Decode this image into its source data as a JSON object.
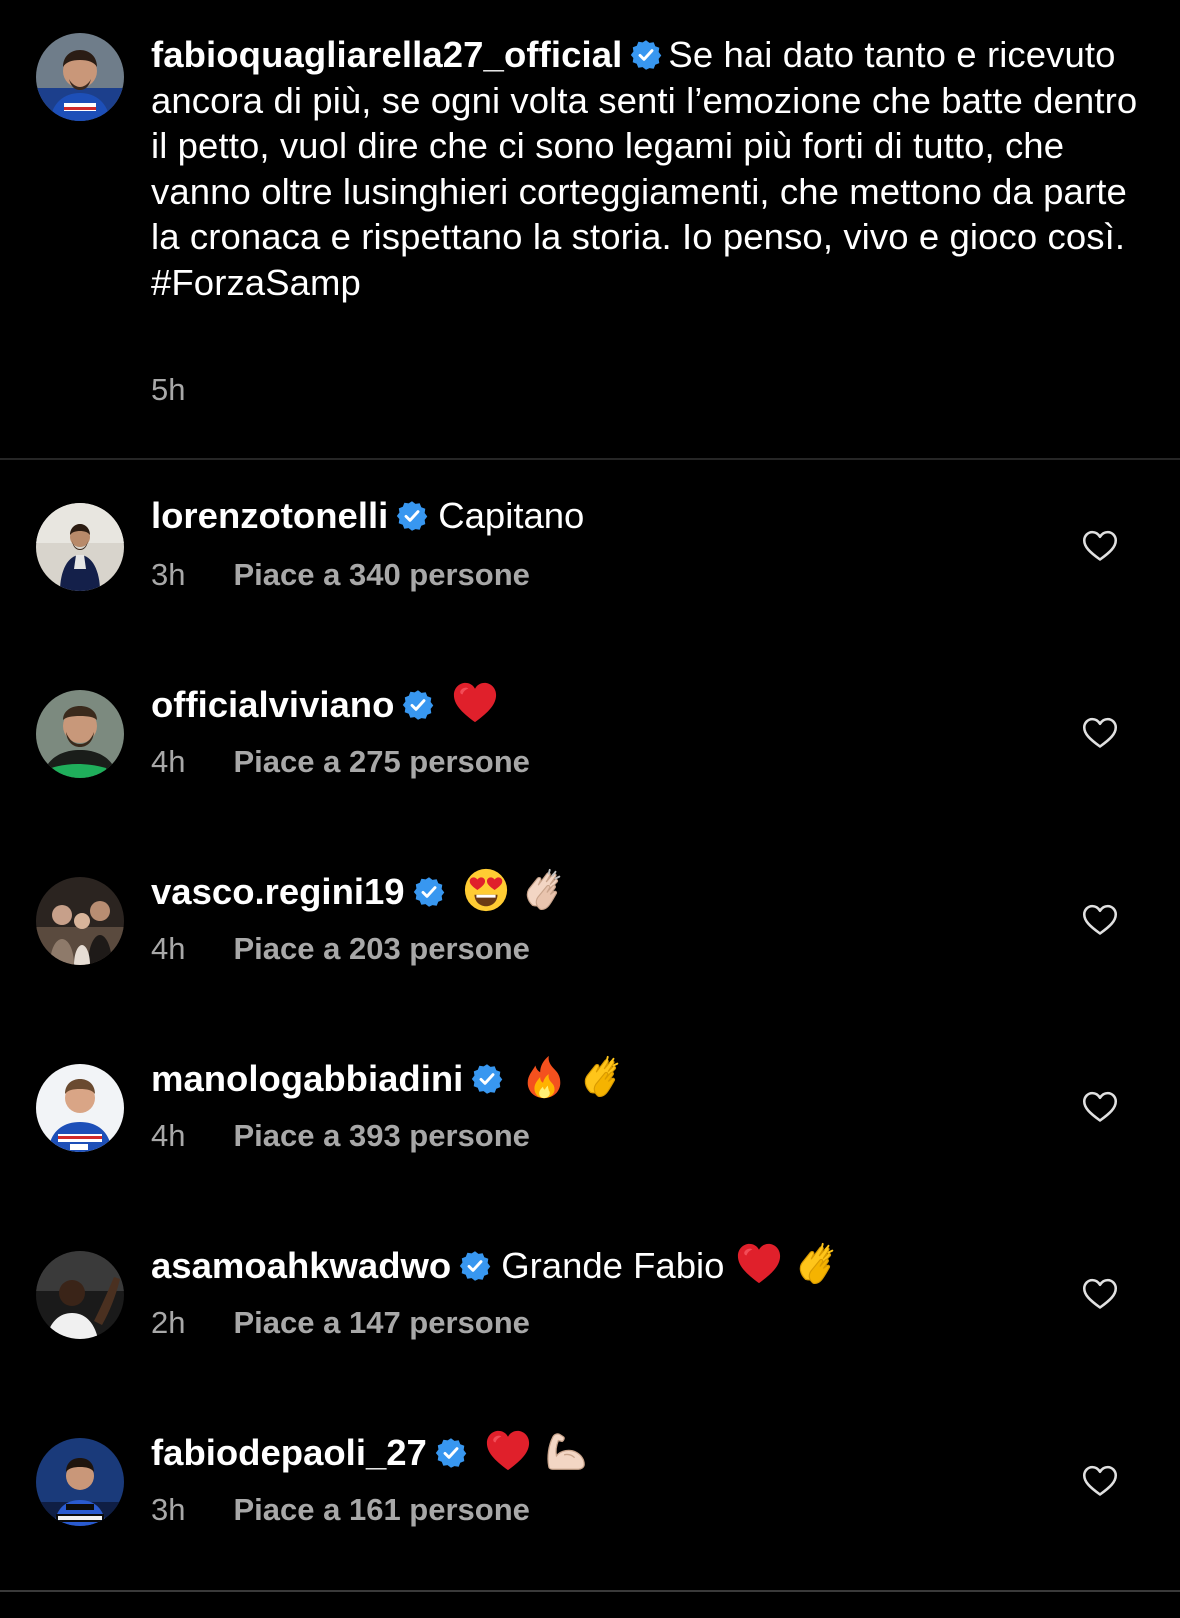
{
  "caption": {
    "username": "fabioquagliarella27_official",
    "text": "Se hai dato tanto e ricevuto ancora di più, se ogni volta senti l’emozione che batte dentro il petto, vuol dire che ci sono legami più forti di tutto, che vanno oltre lusinghieri corteggiamenti, che mettono da parte la cronaca e rispettano la storia. Io penso, vivo e gioco così. #ForzaSamp",
    "time": "5h"
  },
  "comments": [
    {
      "username": "lorenzotonelli",
      "text": "Capitano",
      "time": "3h",
      "likes": "Piace a 340 persone",
      "emojis": []
    },
    {
      "username": "officialviviano",
      "text": "",
      "time": "4h",
      "likes": "Piace a 275 persone",
      "emojis": [
        "red-heart"
      ]
    },
    {
      "username": "vasco.regini19",
      "text": "",
      "time": "4h",
      "likes": "Piace a 203 persone",
      "emojis": [
        "heart-eyes",
        "clapping-hands-light"
      ]
    },
    {
      "username": "manologabbiadini",
      "text": "",
      "time": "4h",
      "likes": "Piace a 393 persone",
      "emojis": [
        "fire",
        "clapping-hands"
      ]
    },
    {
      "username": "asamoahkwadwo",
      "text": "Grande Fabio",
      "time": "2h",
      "likes": "Piace a 147 persone",
      "emojis": [
        "red-heart",
        "clapping-hands"
      ]
    },
    {
      "username": "fabiodepaoli_27",
      "text": "",
      "time": "3h",
      "likes": "Piace a 161 persone",
      "emojis": [
        "red-heart",
        "flexed-biceps-light"
      ]
    }
  ],
  "colors": {
    "background": "#000000",
    "verified": "#3897f0",
    "secondary_text": "#a8a8a8",
    "divider": "#262626"
  },
  "icons": {
    "verified": "verified-badge-icon",
    "like": "heart-outline-icon"
  }
}
